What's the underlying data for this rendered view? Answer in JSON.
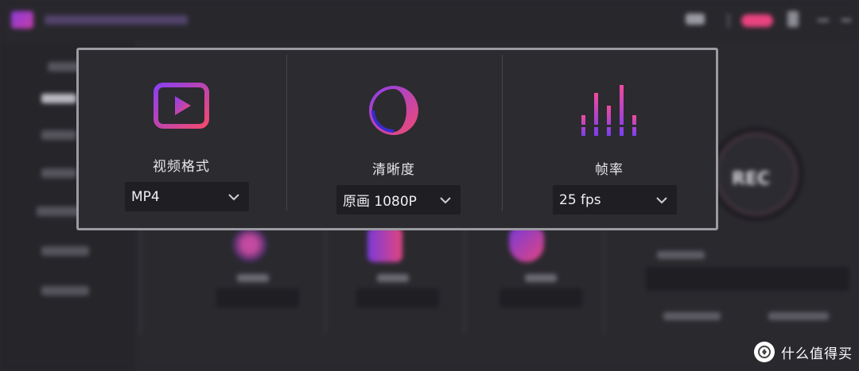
{
  "panel": {
    "format": {
      "label": "视频格式",
      "value": "MP4",
      "icon": "video-play-icon"
    },
    "clarity": {
      "label": "清晰度",
      "value": "原画 1080P",
      "icon": "clarity-half-circle-icon"
    },
    "fps": {
      "label": "帧率",
      "value": "25 fps",
      "icon": "equalizer-bars-icon"
    }
  },
  "background": {
    "record_button": "REC"
  },
  "watermark": {
    "text": "什么值得买"
  },
  "colors": {
    "accent_purple": "#8f3ed6",
    "accent_pink": "#ee4473",
    "panel_bg": "#2c2b30",
    "dropdown_bg": "#1f1e23"
  }
}
